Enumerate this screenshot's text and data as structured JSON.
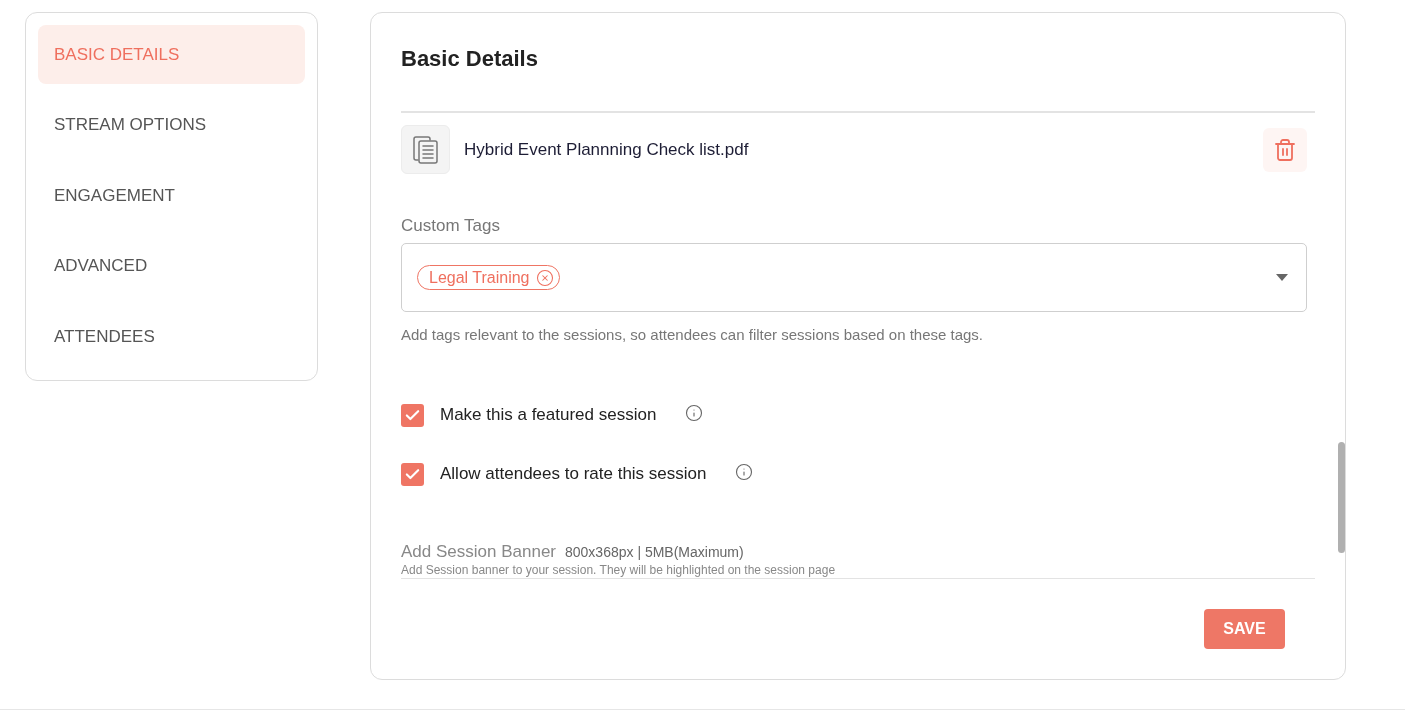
{
  "sidebar": {
    "items": [
      {
        "label": "BASIC DETAILS",
        "selected": true
      },
      {
        "label": "STREAM OPTIONS",
        "selected": false
      },
      {
        "label": "ENGAGEMENT",
        "selected": false
      },
      {
        "label": "ADVANCED",
        "selected": false
      },
      {
        "label": "ATTENDEES",
        "selected": false
      }
    ]
  },
  "main": {
    "title": "Basic Details",
    "attachment": {
      "file_name": "Hybrid Event Plannning Check list.pdf"
    },
    "custom_tags": {
      "label": "Custom Tags",
      "tags": [
        "Legal Training"
      ],
      "help": "Add tags relevant to the sessions, so attendees can filter sessions based on these tags."
    },
    "options": [
      {
        "label": "Make this a featured session",
        "checked": true
      },
      {
        "label": "Allow attendees to rate this session",
        "checked": true
      }
    ],
    "banner": {
      "label": "Add Session Banner",
      "size_hint": "800x368px | 5MB(Maximum)",
      "description": "Add Session banner to your session. They will be highlighted on the session page"
    },
    "save_button": "SAVE"
  }
}
